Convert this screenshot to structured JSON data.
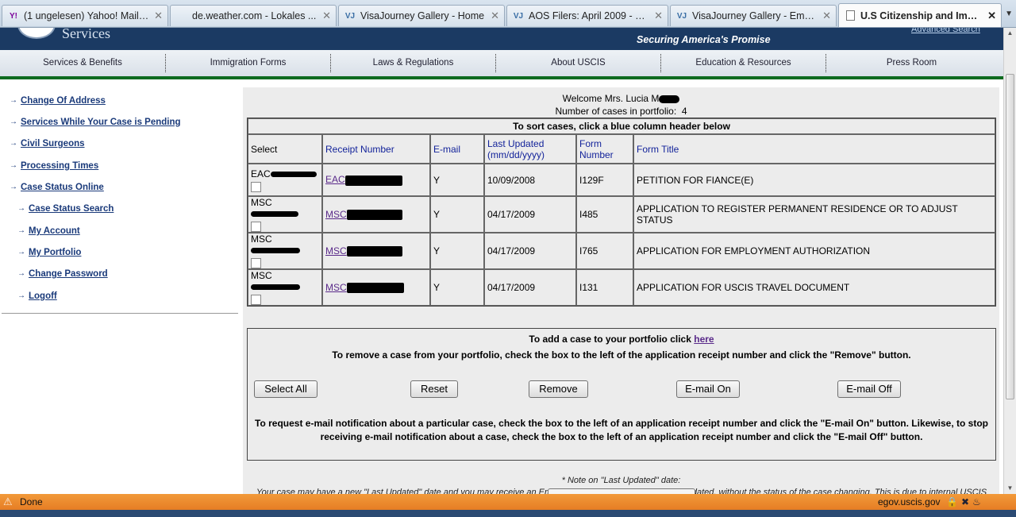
{
  "browser": {
    "tabs": [
      {
        "favicon": "Y!",
        "favicon_color": "#7b0099",
        "title": "(1 ungelesen) Yahoo! Mail, ...",
        "active": false
      },
      {
        "favicon": "",
        "favicon_color": "#999999",
        "title": "de.weather.com - Lokales ...",
        "active": false
      },
      {
        "favicon": "VJ",
        "favicon_color": "#3a6ea5",
        "title": "VisaJourney Gallery - Home",
        "active": false
      },
      {
        "favicon": "VJ",
        "favicon_color": "#3a6ea5",
        "title": "AOS Filers: April 2009 - VisaJ...",
        "active": false
      },
      {
        "favicon": "VJ",
        "favicon_color": "#3a6ea5",
        "title": "VisaJourney Gallery - Emplo...",
        "active": false
      },
      {
        "favicon": "page-icon",
        "favicon_color": "#666666",
        "title": "U.S Citizenship and Immig...",
        "active": true
      }
    ],
    "status_text": "Done",
    "status_domain": "egov.uscis.gov"
  },
  "header": {
    "agency_word": "Services",
    "slogan": "Securing America's Promise",
    "advanced_search": "Advanced Search",
    "bg_color": "#1b3a63"
  },
  "nav": [
    "Services & Benefits",
    "Immigration Forms",
    "Laws & Regulations",
    "About USCIS",
    "Education & Resources",
    "Press Room"
  ],
  "sidebar": [
    {
      "label": "Change Of Address",
      "indent": false
    },
    {
      "label": "Services While Your Case is Pending",
      "indent": false
    },
    {
      "label": "Civil Surgeons",
      "indent": false
    },
    {
      "label": "Processing Times",
      "indent": false
    },
    {
      "label": "Case Status Online",
      "indent": false
    },
    {
      "label": "Case Status Search",
      "indent": true
    },
    {
      "label": "My Account",
      "indent": true
    },
    {
      "label": "My Portfolio",
      "indent": true
    },
    {
      "label": "Change Password",
      "indent": true
    },
    {
      "label": "Logoff",
      "indent": true
    }
  ],
  "main": {
    "welcome": "Welcome Mrs. Lucia M",
    "case_count_label": "Number of cases in portfolio:",
    "case_count": "4",
    "sort_hint": "To sort cases, click a blue column header below",
    "columns": {
      "select": "Select",
      "receipt": "Receipt Number",
      "email": "E-mail",
      "last_updated": "Last Updated",
      "last_updated_fmt": "(mm/dd/yyyy)",
      "form_number": "Form Number",
      "form_title": "Form Title"
    },
    "rows": [
      {
        "select_prefix": "EAC",
        "receipt_prefix": "EAC",
        "email": "Y",
        "updated": "10/09/2008",
        "form": "I129F",
        "title": "PETITION FOR FIANCE(E)"
      },
      {
        "select_prefix": "MSC",
        "receipt_prefix": "MSC",
        "email": "Y",
        "updated": "04/17/2009",
        "form": "I485",
        "title": "APPLICATION TO REGISTER PERMANENT RESIDENCE OR TO ADJUST STATUS"
      },
      {
        "select_prefix": "MSC",
        "receipt_prefix": "MSC",
        "email": "Y",
        "updated": "04/17/2009",
        "form": "I765",
        "title": "APPLICATION FOR EMPLOYMENT AUTHORIZATION"
      },
      {
        "select_prefix": "MSC",
        "receipt_prefix": "MSC",
        "email": "Y",
        "updated": "04/17/2009",
        "form": "I131",
        "title": "APPLICATION FOR USCIS TRAVEL DOCUMENT"
      }
    ],
    "add_case_text": "To add a case to your portfolio click",
    "add_case_link": "here",
    "remove_text": "To remove a case from your portfolio, check the box to the left of the application receipt number and click the \"Remove\" button.",
    "buttons": {
      "select_all": "Select All",
      "reset": "Reset",
      "remove": "Remove",
      "email_on": "E-mail On",
      "email_off": "E-mail Off"
    },
    "email_para": "To request e-mail notification about a particular case, check the box to the left of an application receipt number and click the \"E-mail On\" button. Likewise, to stop receiving e-mail notification about a case, check the box to the left of an application receipt number and click the \"E-mail Off\" button.",
    "note_title": "* Note on \"Last Updated\" date:",
    "note_body": "Your case may have a new \"Last Updated\" date and you may receive an Email Notification of your case being updated, without the status of the case changing. This is due to internal USCIS processing being performed on your Case. This will be reflected in the \"Last Updated\" date, but may not result in a different status message."
  }
}
